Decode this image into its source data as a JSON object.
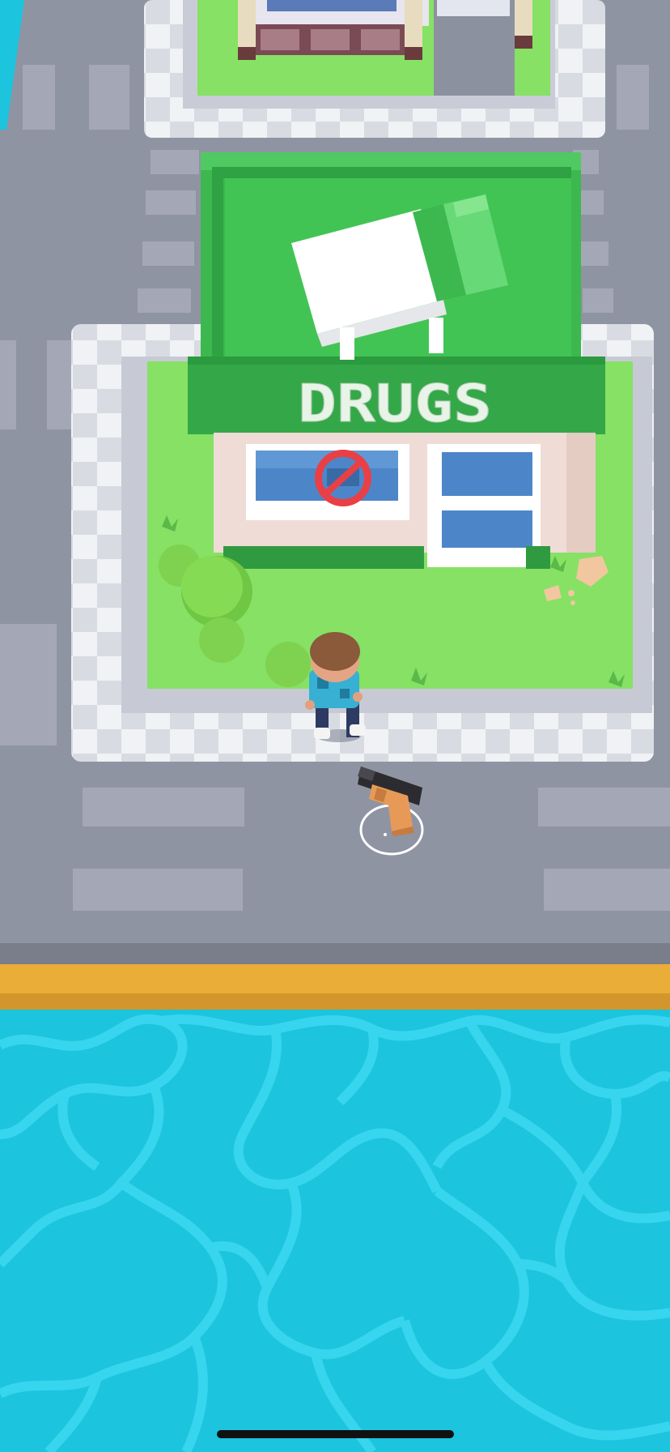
{
  "shop": {
    "sign_text": "DRUGS"
  },
  "icons": {
    "pickup": "pistol-icon",
    "window_sign": "no-symbol-icon",
    "rooftop_prop": "pill-bottle"
  },
  "colors": {
    "road": "#8f94a3",
    "water": "#1cc4de",
    "water_lines": "#37d5ee",
    "curb": "#e9ad38",
    "grass": "#86e165",
    "shop_green": "#3cb84e",
    "sign_text": "#e8f4e8"
  }
}
